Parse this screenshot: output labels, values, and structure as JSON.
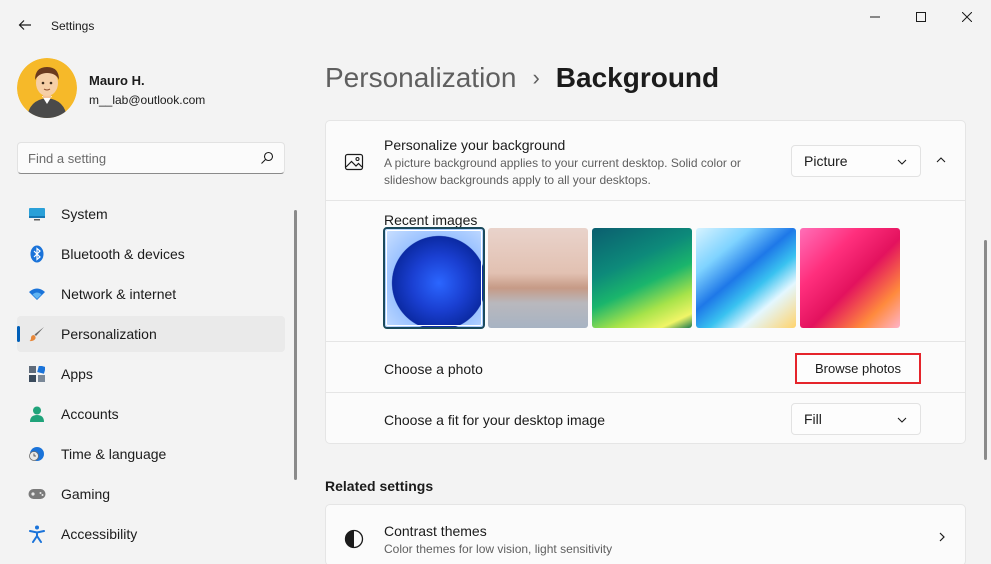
{
  "window": {
    "title": "Settings",
    "back_icon": "back-arrow-icon",
    "controls": [
      "minimize-icon",
      "maximize-icon",
      "close-icon"
    ]
  },
  "profile": {
    "name": "Mauro H.",
    "email": "m__lab@outlook.com"
  },
  "search": {
    "placeholder": "Find a setting",
    "value": ""
  },
  "sidebar": {
    "items": [
      {
        "label": "System",
        "icon": "monitor-icon",
        "active": false
      },
      {
        "label": "Bluetooth & devices",
        "icon": "bluetooth-icon",
        "active": false
      },
      {
        "label": "Network & internet",
        "icon": "wifi-icon",
        "active": false
      },
      {
        "label": "Personalization",
        "icon": "brush-icon",
        "active": true
      },
      {
        "label": "Apps",
        "icon": "apps-icon",
        "active": false
      },
      {
        "label": "Accounts",
        "icon": "person-icon",
        "active": false
      },
      {
        "label": "Time & language",
        "icon": "globe-clock-icon",
        "active": false
      },
      {
        "label": "Gaming",
        "icon": "gamepad-icon",
        "active": false
      },
      {
        "label": "Accessibility",
        "icon": "accessibility-icon",
        "active": false
      }
    ]
  },
  "breadcrumb": {
    "parent": "Personalization",
    "separator": "›",
    "current": "Background"
  },
  "background_card": {
    "title": "Personalize your background",
    "description": "A picture background applies to your current desktop. Solid color or slideshow backgrounds apply to all your desktops.",
    "type_value": "Picture",
    "recent_images_label": "Recent images",
    "recent_images": [
      "bloom-wallpaper",
      "desert-lake-wallpaper",
      "aurora-wallpaper",
      "wave-art-wallpaper",
      "pink-abstract-wallpaper"
    ],
    "selected_image_index": 0,
    "choose_photo_label": "Choose a photo",
    "browse_button": "Browse photos",
    "fit_label": "Choose a fit for your desktop image",
    "fit_value": "Fill"
  },
  "related": {
    "title": "Related settings",
    "contrast_title": "Contrast themes",
    "contrast_desc": "Color themes for low vision, light sensitivity"
  },
  "colors": {
    "accent": "#005fb8",
    "highlight_box": "#e5242b",
    "background": "#f3f3f3",
    "card": "#fbfbfb"
  }
}
